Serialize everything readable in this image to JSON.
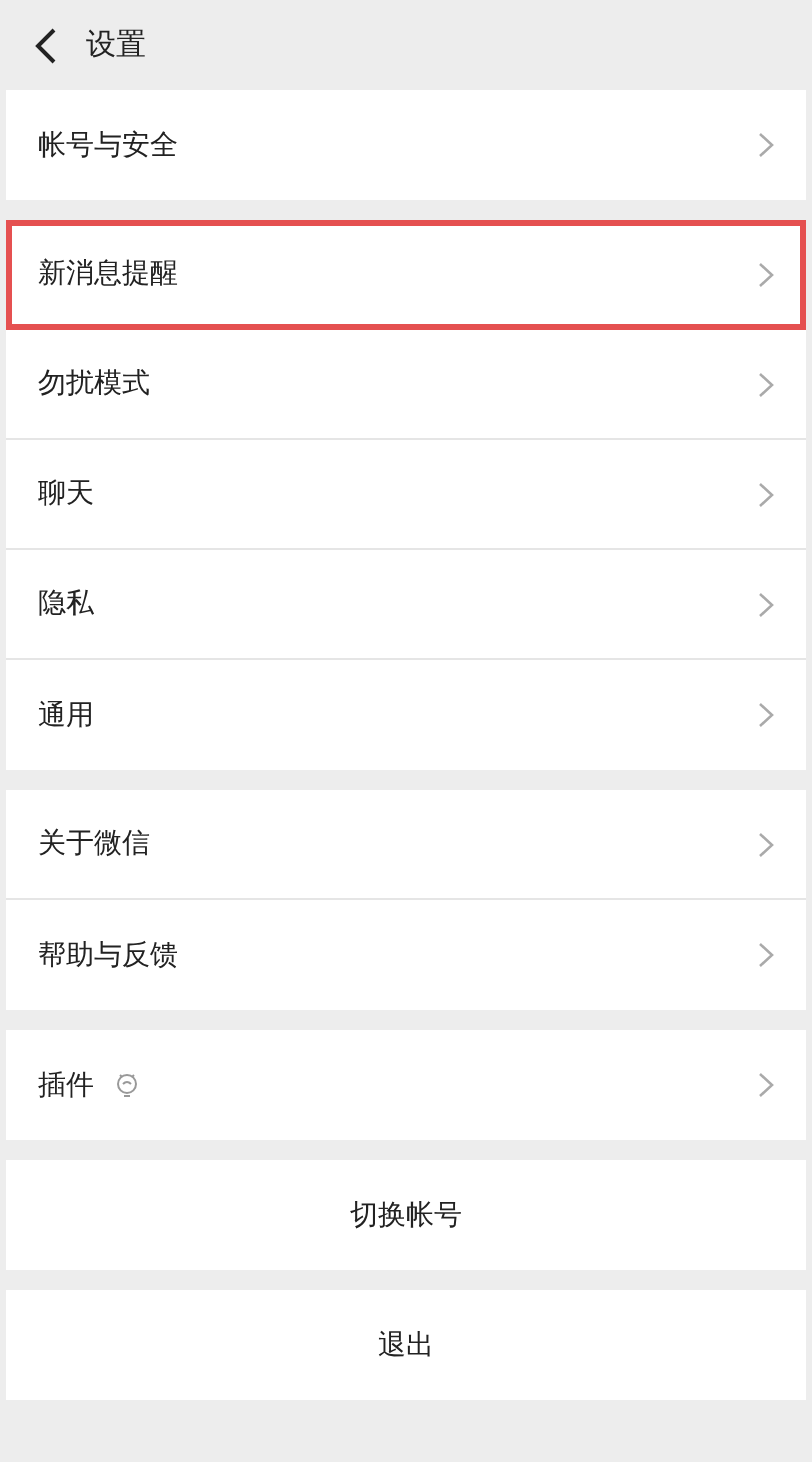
{
  "header": {
    "title": "设置"
  },
  "groups": [
    {
      "items": [
        {
          "label": "帐号与安全",
          "kind": "plain",
          "highlighted": false
        }
      ]
    },
    {
      "items": [
        {
          "label": "新消息提醒",
          "kind": "plain",
          "highlighted": true
        },
        {
          "label": "勿扰模式",
          "kind": "plain",
          "highlighted": false
        },
        {
          "label": "聊天",
          "kind": "plain",
          "highlighted": false
        },
        {
          "label": "隐私",
          "kind": "plain",
          "highlighted": false
        },
        {
          "label": "通用",
          "kind": "plain",
          "highlighted": false
        }
      ]
    },
    {
      "items": [
        {
          "label": "关于微信",
          "kind": "plain",
          "highlighted": false
        },
        {
          "label": "帮助与反馈",
          "kind": "plain",
          "highlighted": false
        }
      ]
    },
    {
      "items": [
        {
          "label": "插件",
          "kind": "with-icon",
          "highlighted": false
        }
      ]
    }
  ],
  "actions": [
    "切换帐号",
    "退出"
  ]
}
